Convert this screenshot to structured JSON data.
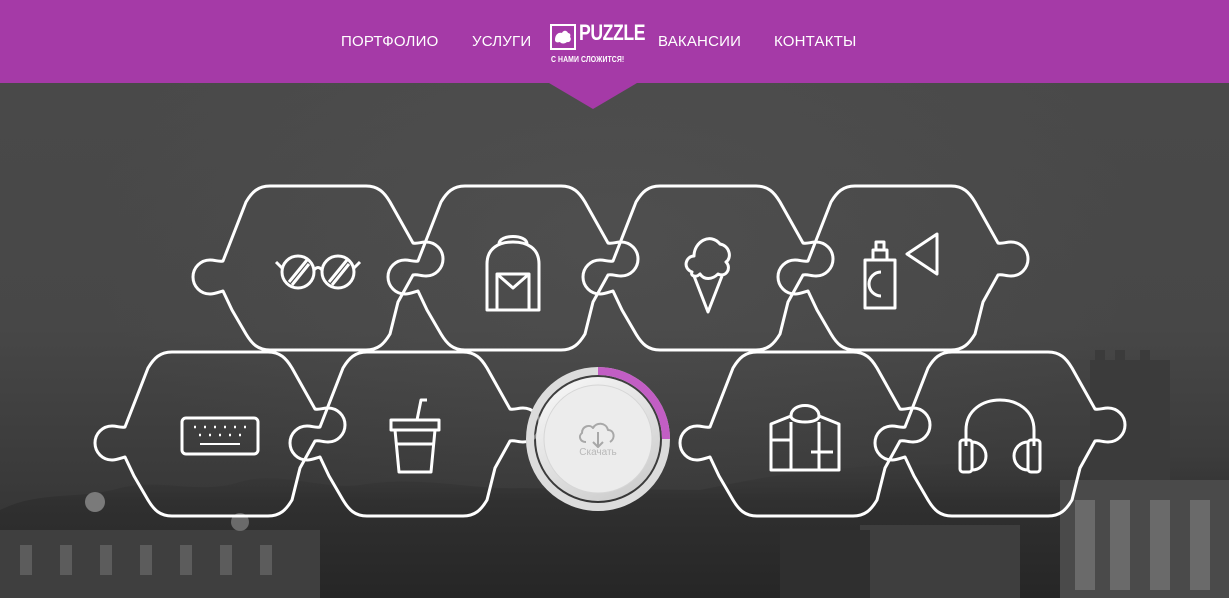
{
  "nav": {
    "portfolio": "ПОРТФОЛИО",
    "services": "УСЛУГИ",
    "vacancies": "ВАКАНСИИ",
    "contacts": "КОНТАКТЫ"
  },
  "logo": {
    "name": "PUZZLE",
    "tagline": "С НАМИ СЛОЖИТСЯ!"
  },
  "download": {
    "label": "Скачать",
    "progress": 0.25
  },
  "icons": [
    "glasses-icon",
    "backpack-icon",
    "ice-cream-icon",
    "spray-can-icon",
    "keyboard-icon",
    "drink-cup-icon",
    "shirt-icon",
    "headphones-icon"
  ],
  "colors": {
    "brand": "#a53aa7",
    "progress": "#c25ec4",
    "background": "#444444"
  }
}
